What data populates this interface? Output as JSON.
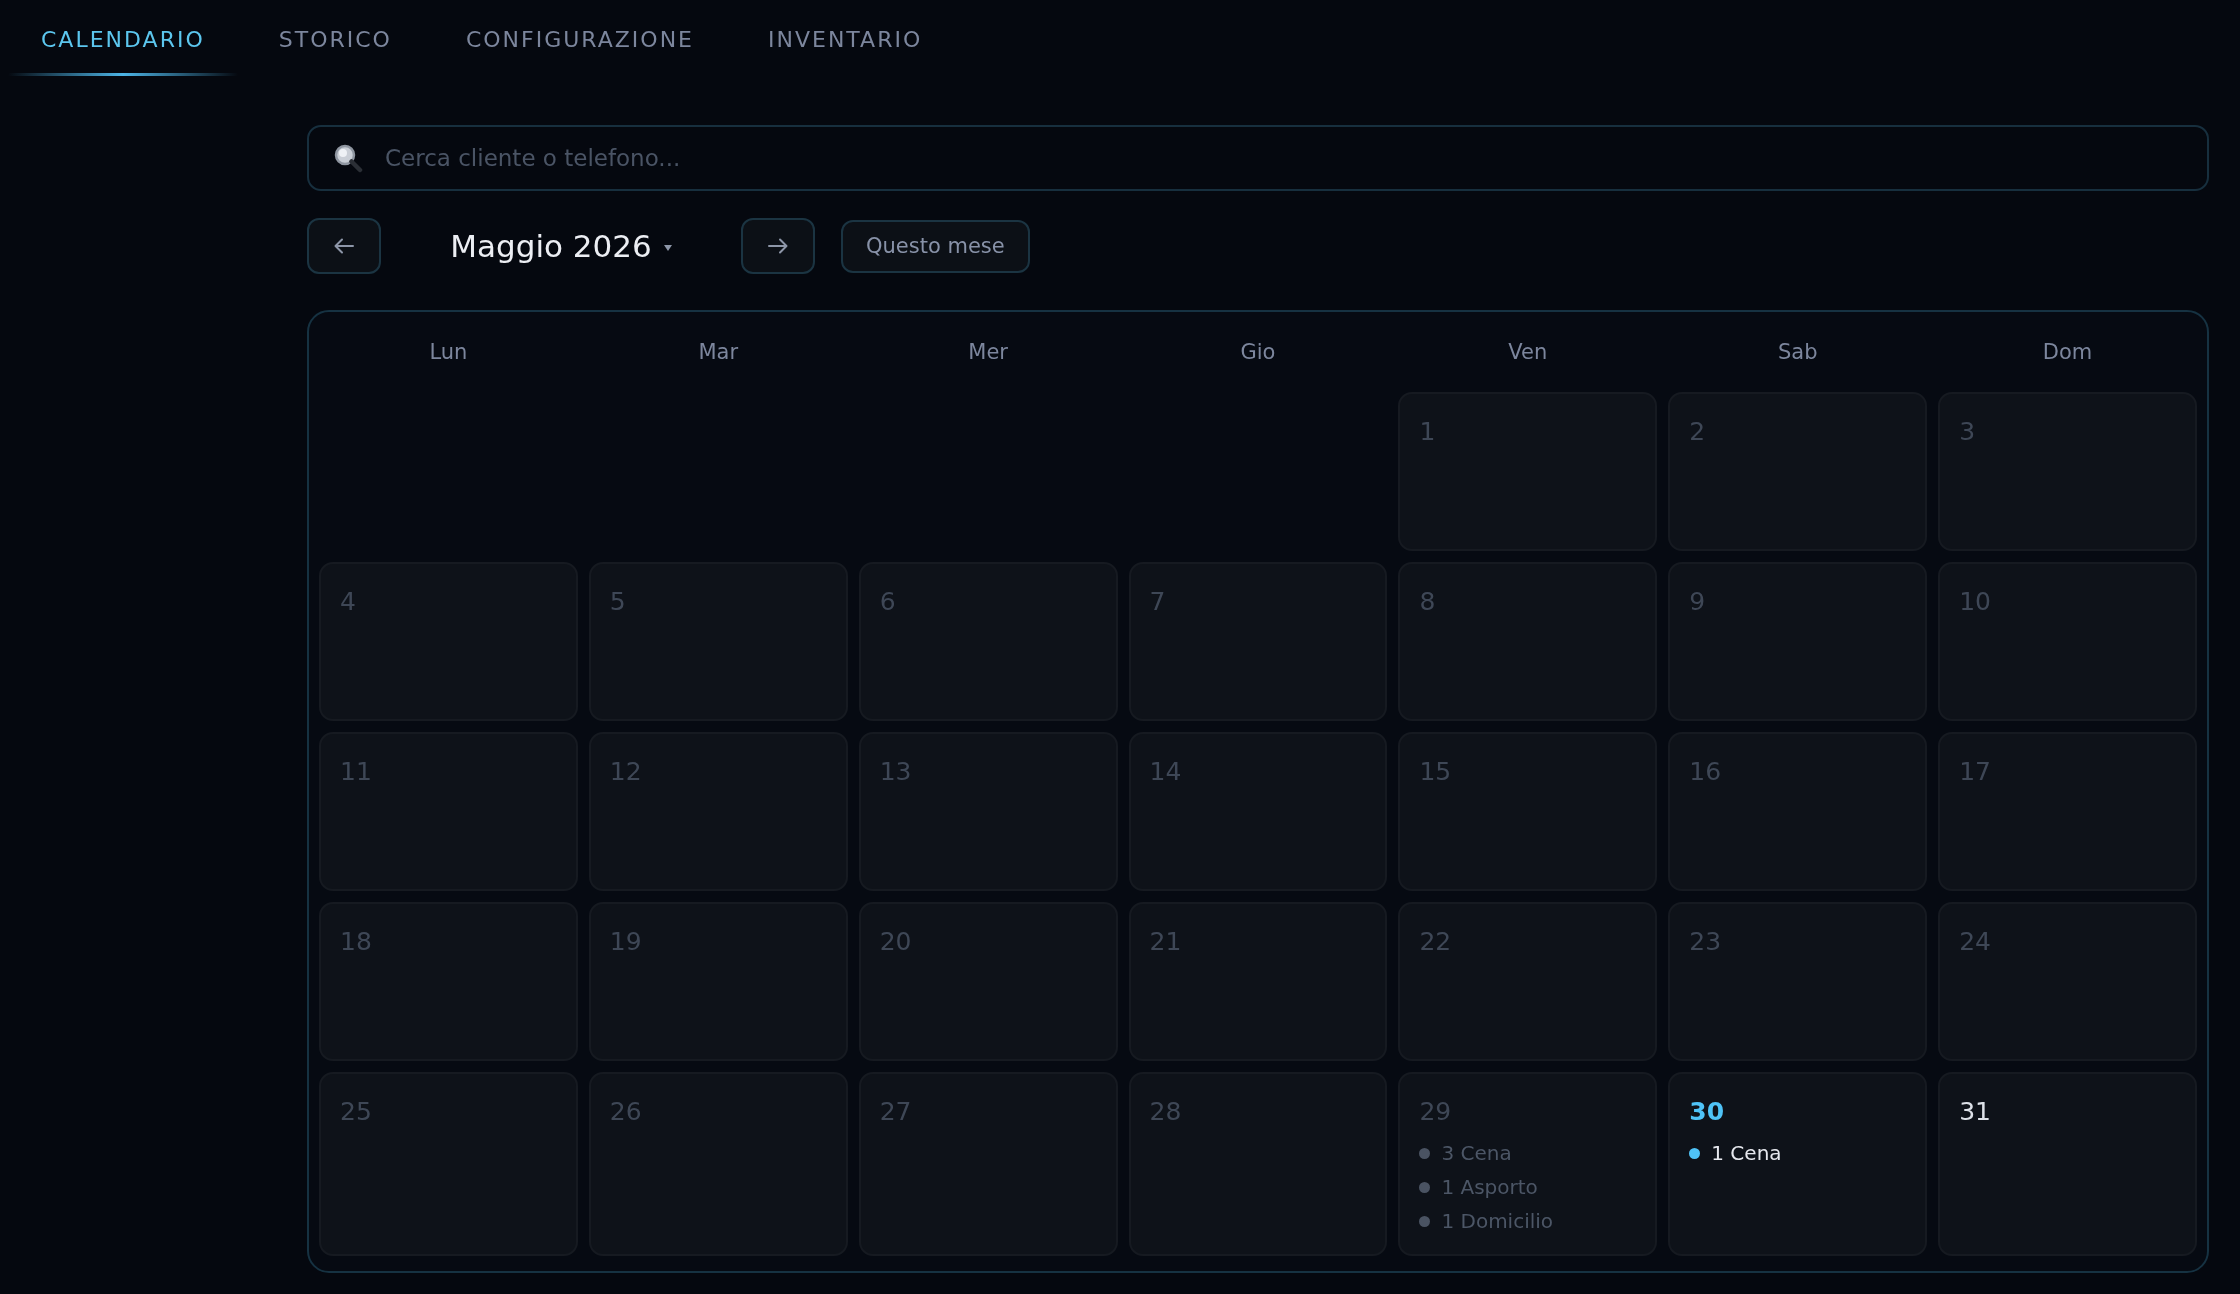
{
  "tabs": [
    {
      "label": "CALENDARIO",
      "selected": true
    },
    {
      "label": "STORICO",
      "selected": false
    },
    {
      "label": "CONFIGURAZIONE",
      "selected": false
    },
    {
      "label": "INVENTARIO",
      "selected": false
    }
  ],
  "search": {
    "placeholder": "Cerca cliente o telefono..."
  },
  "month_nav": {
    "title": "Maggio 2026",
    "today_button": "Questo mese"
  },
  "calendar": {
    "weekdays": [
      "Lun",
      "Mar",
      "Mer",
      "Gio",
      "Ven",
      "Sab",
      "Dom"
    ],
    "weeks": [
      {
        "days": [
          {
            "number": "1",
            "kind": "past"
          },
          {
            "number": "2",
            "kind": "past"
          },
          {
            "number": "3",
            "kind": "past"
          }
        ]
      },
      {
        "days": [
          {
            "number": "4",
            "kind": "past"
          },
          {
            "number": "5",
            "kind": "past"
          },
          {
            "number": "6",
            "kind": "past"
          },
          {
            "number": "7",
            "kind": "past"
          },
          {
            "number": "8",
            "kind": "past"
          },
          {
            "number": "9",
            "kind": "past"
          },
          {
            "number": "10",
            "kind": "past"
          }
        ]
      },
      {
        "days": [
          {
            "number": "11",
            "kind": "past"
          },
          {
            "number": "12",
            "kind": "past"
          },
          {
            "number": "13",
            "kind": "past"
          },
          {
            "number": "14",
            "kind": "past"
          },
          {
            "number": "15",
            "kind": "past"
          },
          {
            "number": "16",
            "kind": "past"
          },
          {
            "number": "17",
            "kind": "past"
          }
        ]
      },
      {
        "days": [
          {
            "number": "18",
            "kind": "past"
          },
          {
            "number": "19",
            "kind": "past"
          },
          {
            "number": "20",
            "kind": "past"
          },
          {
            "number": "21",
            "kind": "past"
          },
          {
            "number": "22",
            "kind": "past"
          },
          {
            "number": "23",
            "kind": "past"
          },
          {
            "number": "24",
            "kind": "past"
          }
        ]
      },
      {
        "days": [
          {
            "number": "25",
            "kind": "past"
          },
          {
            "number": "26",
            "kind": "past"
          },
          {
            "number": "27",
            "kind": "past"
          },
          {
            "number": "28",
            "kind": "past"
          },
          {
            "number": "29",
            "kind": "past",
            "events": [
              "3 Cena",
              "1 Asporto",
              "1 Domicilio"
            ]
          },
          {
            "number": "30",
            "kind": "today",
            "events": [
              "1 Cena"
            ]
          },
          {
            "number": "31",
            "kind": "future"
          }
        ]
      }
    ]
  }
}
